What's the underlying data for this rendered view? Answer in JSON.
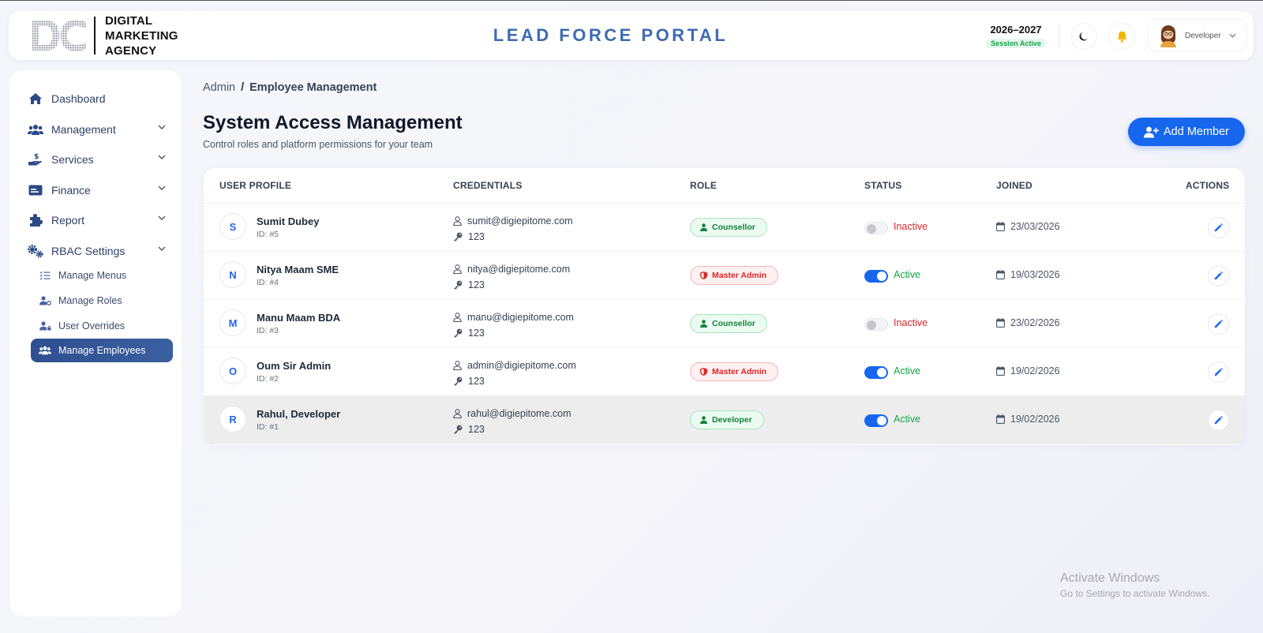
{
  "header": {
    "logo_lines": [
      "DIGITAL",
      "MARKETING",
      "AGENCY"
    ],
    "portal_title": "LEAD FORCE PORTAL",
    "session_year": "2026–2027",
    "session_status": "Session Active",
    "user_name": "Developer"
  },
  "sidebar": {
    "items": [
      {
        "label": "Dashboard"
      },
      {
        "label": "Management"
      },
      {
        "label": "Services"
      },
      {
        "label": "Finance"
      },
      {
        "label": "Report"
      },
      {
        "label": "RBAC Settings"
      }
    ],
    "subitems": [
      {
        "label": "Manage Menus"
      },
      {
        "label": "Manage Roles"
      },
      {
        "label": "User Overrides"
      },
      {
        "label": "Manage Employees"
      }
    ]
  },
  "breadcrumb": {
    "root": "Admin",
    "sep": "/",
    "current": "Employee Management"
  },
  "page": {
    "title": "System Access Management",
    "subtitle": "Control roles and platform permissions for your team",
    "add_button": "Add Member"
  },
  "table": {
    "headers": [
      "USER PROFILE",
      "CREDENTIALS",
      "ROLE",
      "STATUS",
      "JOINED",
      "ACTIONS"
    ],
    "rows": [
      {
        "initial": "S",
        "name": "Sumit Dubey",
        "id": "ID: #5",
        "email": "sumit@digiepitome.com",
        "password": "123",
        "role": "Counsellor",
        "status": "Inactive",
        "joined": "23/03/2026"
      },
      {
        "initial": "N",
        "name": "Nitya Maam SME",
        "id": "ID: #4",
        "email": "nitya@digiepitome.com",
        "password": "123",
        "role": "Master Admin",
        "status": "Active",
        "joined": "19/03/2026"
      },
      {
        "initial": "M",
        "name": "Manu Maam BDA",
        "id": "ID: #3",
        "email": "manu@digiepitome.com",
        "password": "123",
        "role": "Counsellor",
        "status": "Inactive",
        "joined": "23/02/2026"
      },
      {
        "initial": "O",
        "name": "Oum Sir Admin",
        "id": "ID: #2",
        "email": "admin@digiepitome.com",
        "password": "123",
        "role": "Master Admin",
        "status": "Active",
        "joined": "19/02/2026"
      },
      {
        "initial": "R",
        "name": "Rahul, Developer",
        "id": "ID: #1",
        "email": "rahul@digiepitome.com",
        "password": "123",
        "role": "Developer",
        "status": "Active",
        "joined": "19/02/2026"
      }
    ]
  },
  "watermark": {
    "line1": "Activate Windows",
    "line2": "Go to Settings to activate Windows."
  },
  "colors": {
    "accent": "#1667ee",
    "brand_blue": "#3d6bb3",
    "sidebar_active": "#2f4f8f",
    "active_green": "#16a34a",
    "inactive_red": "#dc2626"
  }
}
